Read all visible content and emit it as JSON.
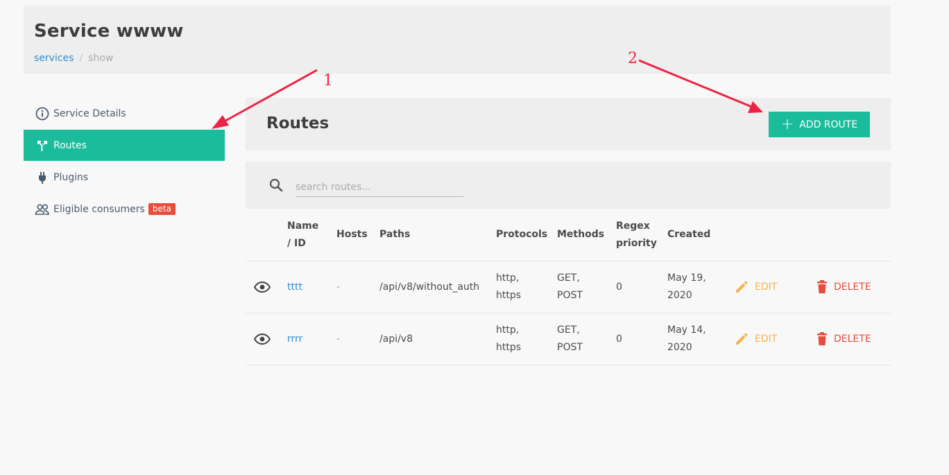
{
  "header": {
    "title": "Service wwww",
    "breadcrumb": {
      "link": "services",
      "separator": "/",
      "current": "show"
    }
  },
  "sidebar": {
    "items": [
      {
        "label": "Service Details",
        "icon": "info-icon"
      },
      {
        "label": "Routes",
        "icon": "routes-icon",
        "active": true
      },
      {
        "label": "Plugins",
        "icon": "plug-icon"
      },
      {
        "label": "Eligible consumers",
        "icon": "users-icon",
        "badge": "beta"
      }
    ]
  },
  "routes": {
    "title": "Routes",
    "add_button": "ADD ROUTE",
    "search_placeholder": "search routes...",
    "columns": [
      "Name / ID",
      "Hosts",
      "Paths",
      "Protocols",
      "Methods",
      "Regex priority",
      "Created"
    ],
    "column_lines": {
      "name": [
        "Name",
        "/ ID"
      ],
      "regex": [
        "Regex",
        "priority"
      ]
    },
    "rows": [
      {
        "name": "tttt",
        "hosts": "-",
        "path": "/api/v8/without_auth",
        "protocols": [
          "http,",
          "https"
        ],
        "methods": [
          "GET,",
          "POST"
        ],
        "priority": "0",
        "created": [
          "May 19,",
          "2020"
        ],
        "edit": "EDIT",
        "delete": "DELETE"
      },
      {
        "name": "rrrr",
        "hosts": "-",
        "path": "/api/v8",
        "protocols": [
          "http,",
          "https"
        ],
        "methods": [
          "GET,",
          "POST"
        ],
        "priority": "0",
        "created": [
          "May 14,",
          "2020"
        ],
        "edit": "EDIT",
        "delete": "DELETE"
      }
    ]
  },
  "annotations": {
    "first": "1",
    "second": "2"
  },
  "colors": {
    "accent": "#1abc9c",
    "edit": "#f5b44e",
    "delete": "#e74c3c",
    "link": "#2f8fcf",
    "annotation": "#ee2244"
  }
}
